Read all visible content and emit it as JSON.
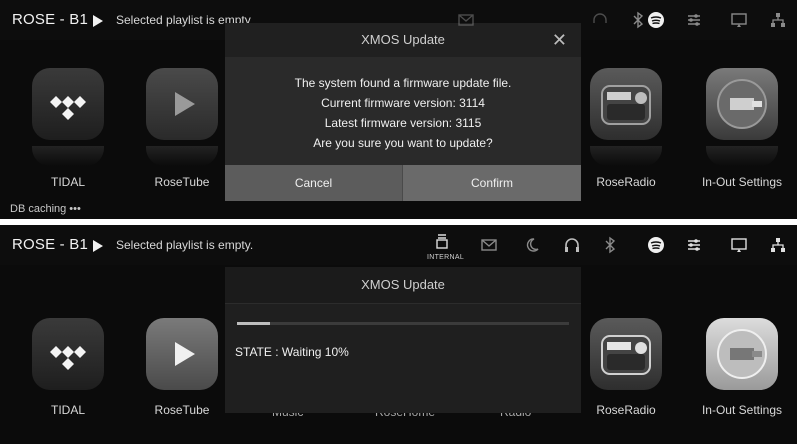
{
  "device_name": "ROSE - B1",
  "top_panel": {
    "status_text": "Selected playlist is empty",
    "db_caching": "DB caching •••",
    "dialog": {
      "title": "XMOS Update",
      "close_glyph": "✕",
      "lines": [
        "The system found a firmware update file.",
        "Current firmware version: 3114",
        "Latest firmware version: 3115",
        "Are you sure you want to update?"
      ],
      "cancel_label": "Cancel",
      "confirm_label": "Confirm"
    }
  },
  "bottom_panel": {
    "status_text": "Selected playlist is empty.",
    "internal_label": "INTERNAL",
    "dialog": {
      "title": "XMOS Update",
      "state_text": "STATE : Waiting 10%",
      "progress_percent": 10
    },
    "partial_labels": [
      "Music",
      "RoseHome",
      "Radio"
    ]
  },
  "apps": [
    {
      "label": "TIDAL",
      "icon": "tidal-icon"
    },
    {
      "label": "RoseTube",
      "icon": "rosetube-icon"
    },
    {
      "label": "RoseRadio",
      "icon": "roseradio-icon"
    },
    {
      "label": "In-Out Settings",
      "icon": "in-out-settings-icon"
    }
  ],
  "status_icons": [
    "usb-icon",
    "mail-icon",
    "headphones-icon",
    "bluetooth-icon",
    "spotify-icon",
    "equalizer-icon",
    "screen-icon",
    "network-icon"
  ],
  "colors": {
    "background": "#0b0b0b",
    "dialog": "#2a2a2a",
    "button_cancel": "#5c5c5c",
    "button_confirm": "#6a6a6a"
  }
}
